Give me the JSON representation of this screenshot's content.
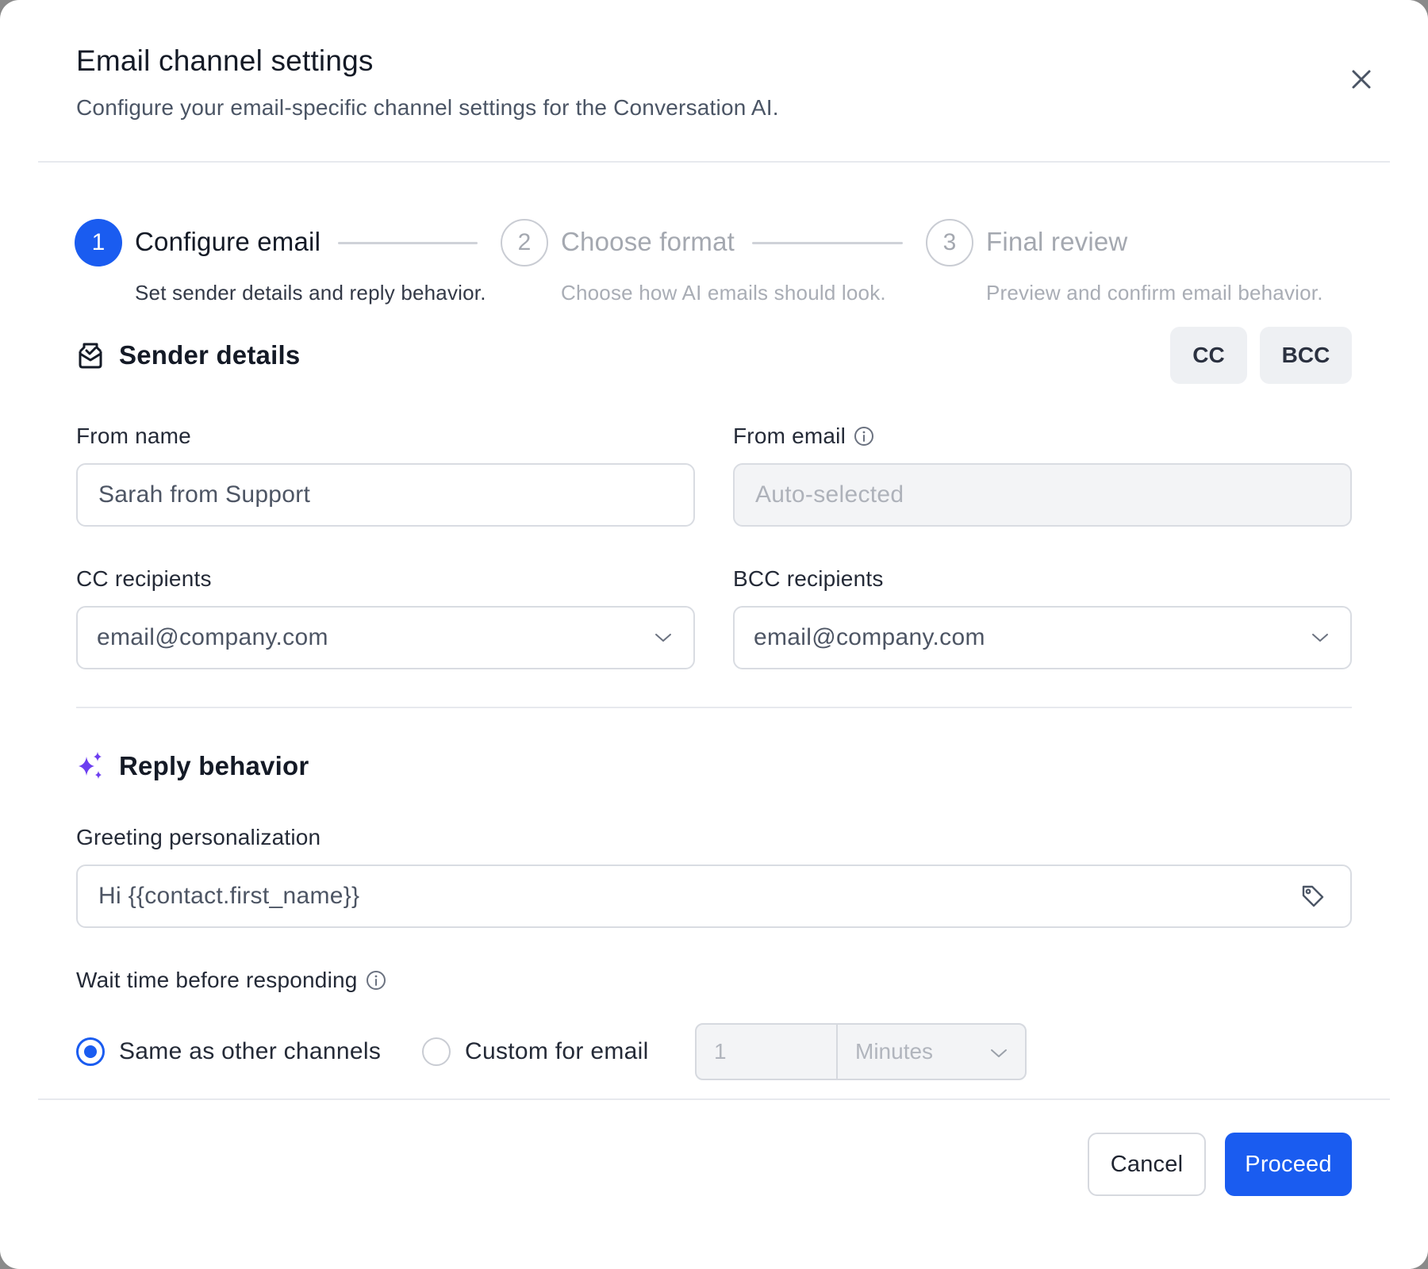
{
  "header": {
    "title": "Email channel settings",
    "subtitle": "Configure your email-specific channel settings for the Conversation AI.",
    "close_icon": "close-icon"
  },
  "stepper": {
    "steps": [
      {
        "number": "1",
        "title": "Configure email",
        "description": "Set sender details and reply behavior.",
        "state": "active"
      },
      {
        "number": "2",
        "title": "Choose format",
        "description": "Choose how AI emails should look.",
        "state": "inactive"
      },
      {
        "number": "3",
        "title": "Final review",
        "description": "Preview and confirm email behavior.",
        "state": "inactive"
      }
    ]
  },
  "sender": {
    "title": "Sender details",
    "icon": "envelope-check-icon",
    "cc_toggle": "CC",
    "bcc_toggle": "BCC",
    "from_name_label": "From name",
    "from_name_value": "Sarah from Support",
    "from_email_label": "From email",
    "from_email_placeholder": "Auto-selected",
    "cc_label": "CC recipients",
    "cc_value": "email@company.com",
    "bcc_label": "BCC recipients",
    "bcc_value": "email@company.com"
  },
  "reply": {
    "title": "Reply behavior",
    "icon": "sparkles-icon",
    "greeting_label": "Greeting personalization",
    "greeting_value": "Hi {{contact.first_name}}",
    "wait_label": "Wait time before responding",
    "options": [
      {
        "label": "Same as other channels",
        "checked": true
      },
      {
        "label": "Custom for email",
        "checked": false
      }
    ],
    "wait_amount": "1",
    "wait_unit": "Minutes"
  },
  "footer": {
    "cancel_label": "Cancel",
    "proceed_label": "Proceed"
  },
  "colors": {
    "accent": "#1a5cf0",
    "sparkle": "#6d3ff0"
  }
}
